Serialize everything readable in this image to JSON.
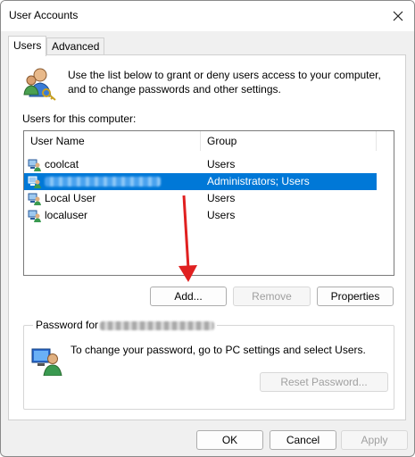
{
  "window": {
    "title": "User Accounts"
  },
  "tabs": [
    {
      "label": "Users",
      "active": true
    },
    {
      "label": "Advanced",
      "active": false
    }
  ],
  "intro": {
    "text": "Use the list below to grant or deny users access to your computer,\nand to change passwords and other settings.",
    "icon": "users-keys-icon"
  },
  "users_section": {
    "label": "Users for this computer:",
    "columns": [
      "User Name",
      "Group"
    ],
    "rows": [
      {
        "name": "coolcat",
        "group": "Users",
        "selected": false,
        "redacted": false
      },
      {
        "name": "",
        "group": "Administrators; Users",
        "selected": true,
        "redacted": true
      },
      {
        "name": "Local User",
        "group": "Users",
        "selected": false,
        "redacted": false
      },
      {
        "name": "localuser",
        "group": "Users",
        "selected": false,
        "redacted": false
      }
    ]
  },
  "user_buttons": {
    "add": "Add...",
    "remove": "Remove",
    "properties": "Properties"
  },
  "password": {
    "legend": "Password for",
    "text": "To change your password, go to PC settings and select Users.",
    "reset_button": "Reset Password..."
  },
  "footer": {
    "ok": "OK",
    "cancel": "Cancel",
    "apply": "Apply"
  },
  "colors": {
    "selection": "#0078d7",
    "annotation_arrow": "#e02020"
  }
}
